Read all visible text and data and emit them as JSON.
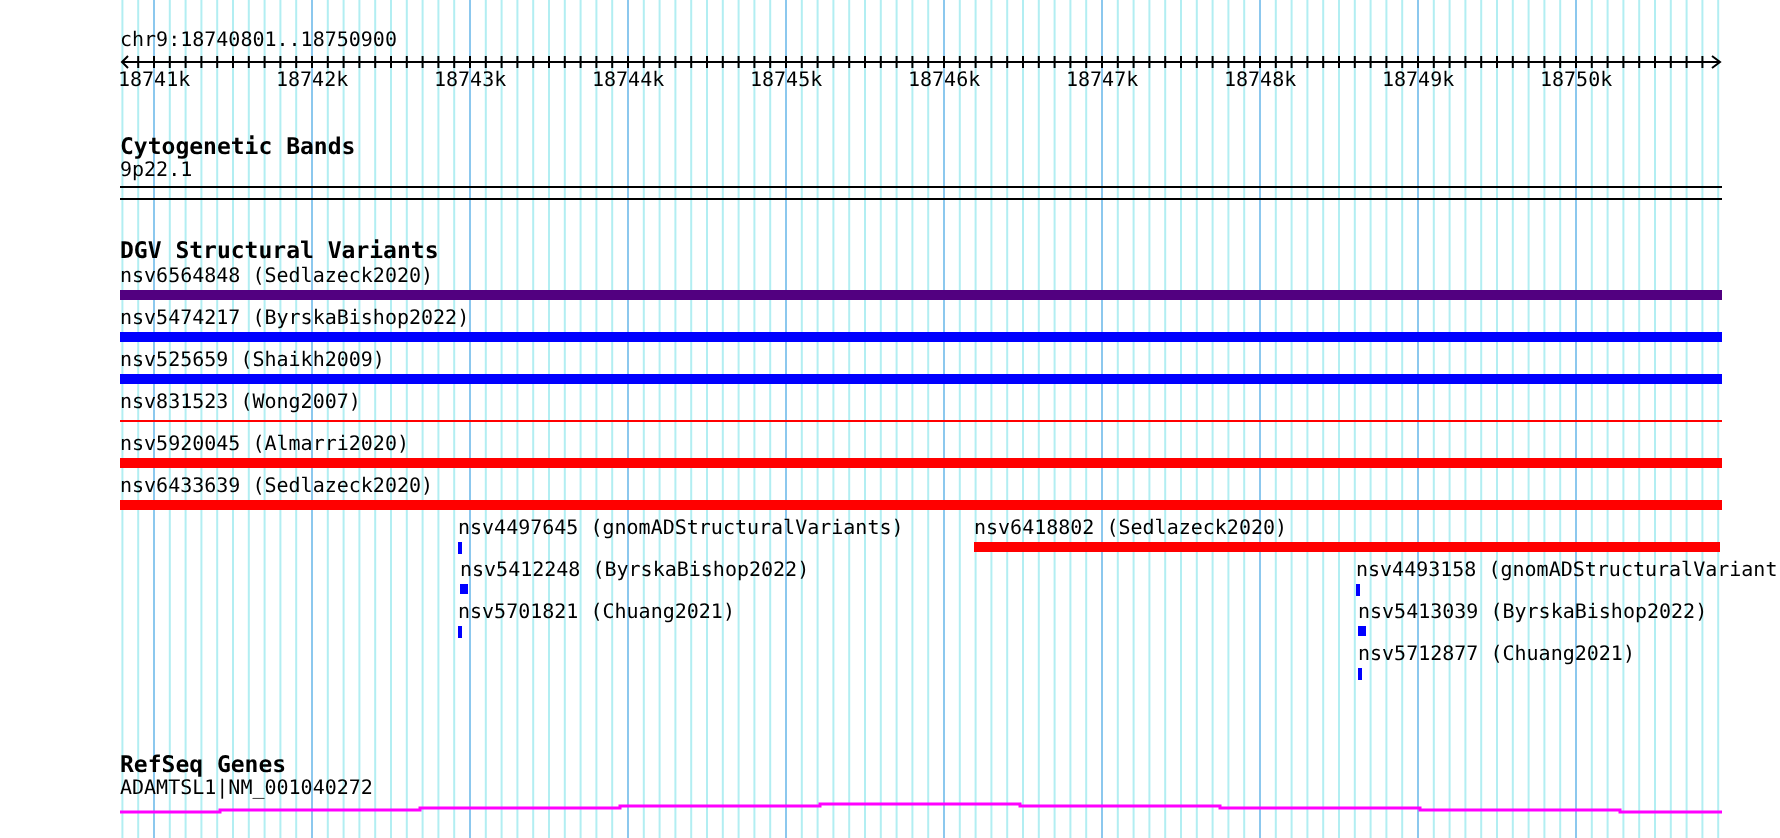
{
  "ruler": {
    "location": "chr9:18740801..18750900",
    "tick_labels": [
      "18741k",
      "18742k",
      "18743k",
      "18744k",
      "18745k",
      "18746k",
      "18747k",
      "18748k",
      "18749k",
      "18750k"
    ]
  },
  "tracks": [
    {
      "kind": "cytoband",
      "title": "Cytogenetic Bands",
      "band": "9p22.1"
    },
    {
      "kind": "variants",
      "title": "DGV Structural Variants",
      "lanes": [
        {
          "features": [
            {
              "label": "nsv6564848 (Sedlazeck2020)",
              "kind": "bar",
              "color": "#520080"
            }
          ]
        },
        {
          "features": [
            {
              "label": "nsv5474217 (ByrskaBishop2022)",
              "kind": "bar",
              "color": "#0000ff"
            }
          ]
        },
        {
          "features": [
            {
              "label": "nsv525659 (Shaikh2009)",
              "kind": "bar",
              "color": "#0000ff"
            }
          ]
        },
        {
          "features": [
            {
              "label": "nsv831523 (Wong2007)",
              "kind": "line",
              "color": "#ff0000"
            }
          ]
        },
        {
          "features": [
            {
              "label": "nsv5920045 (Almarri2020)",
              "kind": "bar",
              "color": "#ff0000"
            }
          ]
        },
        {
          "features": [
            {
              "label": "nsv6433639 (Sedlazeck2020)",
              "kind": "bar",
              "color": "#ff0000"
            }
          ]
        },
        {
          "features": [
            {
              "label": "nsv4497645 (gnomADStructuralVariants)",
              "kind": "point",
              "color": "#0000ff"
            },
            {
              "label": "nsv6418802 (Sedlazeck2020)",
              "kind": "bar",
              "color": "#ff0000"
            }
          ]
        },
        {
          "features": [
            {
              "label": "nsv5412248 (ByrskaBishop2022)",
              "kind": "bar",
              "color": "#0000ff"
            },
            {
              "label": "nsv4493158 (gnomADStructuralVariant",
              "kind": "point",
              "color": "#0000ff"
            }
          ]
        },
        {
          "features": [
            {
              "label": "nsv5701821 (Chuang2021)",
              "kind": "point",
              "color": "#0000ff"
            },
            {
              "label": "nsv5413039 (ByrskaBishop2022)",
              "kind": "bar",
              "color": "#0000ff"
            }
          ]
        },
        {
          "features": [
            {
              "label": "nsv5712877 (Chuang2021)",
              "kind": "point",
              "color": "#0000ff"
            }
          ]
        }
      ]
    },
    {
      "kind": "gene",
      "title": "RefSeq Genes",
      "gene": "ADAMTSL1|NM_001040272"
    }
  ]
}
